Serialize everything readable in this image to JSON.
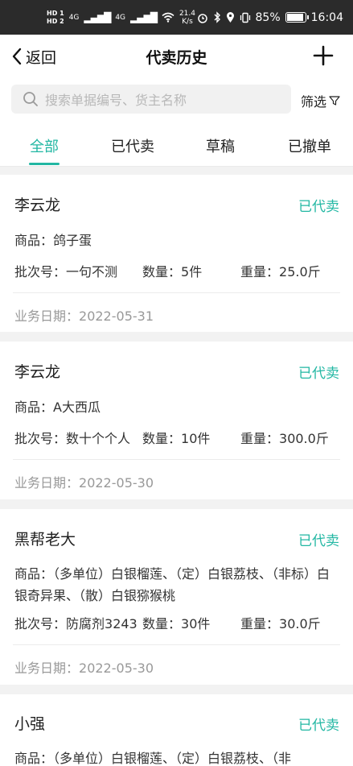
{
  "status_bar": {
    "hd_top": "HD 1",
    "hd_bottom": "HD 2",
    "net_1": "4G",
    "net_2": "4G",
    "speed_value": "21.4",
    "speed_unit": "K/s",
    "battery": "85%",
    "time": "16:04"
  },
  "navbar": {
    "back_label": "返回",
    "title": "代卖历史"
  },
  "search": {
    "placeholder": "搜索单据编号、货主名称",
    "filter_label": "筛选"
  },
  "tabs": [
    "全部",
    "已代卖",
    "草稿",
    "已撤单"
  ],
  "labels": {
    "product": "商品：",
    "batch": "批次号：",
    "qty": "数量：",
    "weight": "重量：",
    "date": "业务日期："
  },
  "records": [
    {
      "name": "李云龙",
      "status": "已代卖",
      "product": "鸽子蛋",
      "batch": "一句不测",
      "qty": "5件",
      "weight": "25.0斤",
      "date": "2022-05-31"
    },
    {
      "name": "李云龙",
      "status": "已代卖",
      "product": "A大西瓜",
      "batch": "数十个个人",
      "qty": "10件",
      "weight": "300.0斤",
      "date": "2022-05-30"
    },
    {
      "name": "黑帮老大",
      "status": "已代卖",
      "product": "（多单位）白银榴莲、（定）白银荔枝、（非标）白银奇异果、（散）白银猕猴桃",
      "batch": "防腐剂3243",
      "qty": "30件",
      "weight": "30.0斤",
      "date": "2022-05-30"
    },
    {
      "name": "小强",
      "status": "已代卖",
      "product": "（多单位）白银榴莲、（定）白银荔枝、（非",
      "batch": "",
      "qty": "",
      "weight": "",
      "date": ""
    }
  ]
}
